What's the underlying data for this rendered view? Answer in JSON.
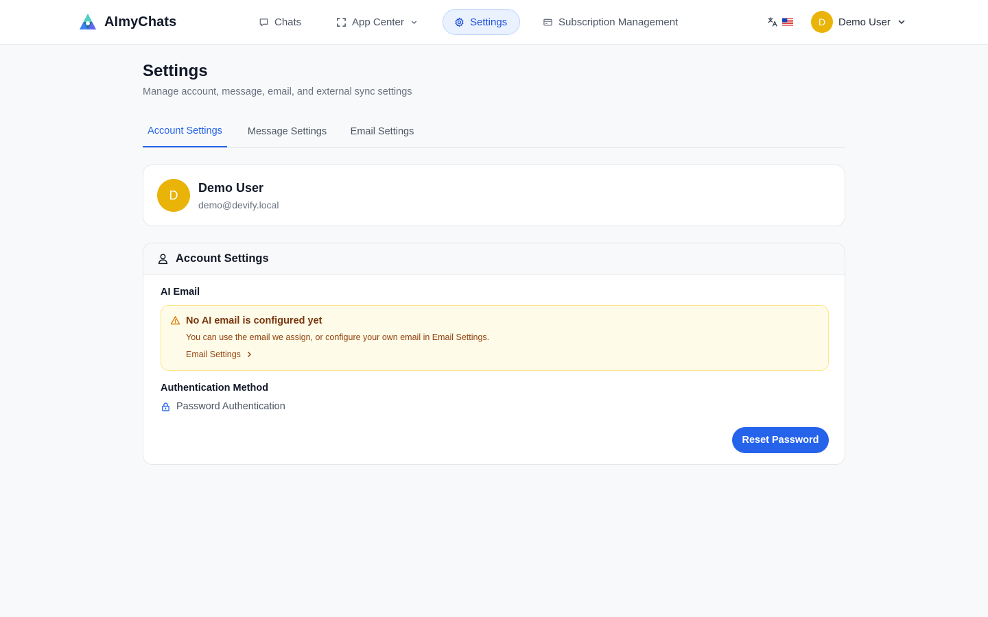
{
  "app": {
    "name": "AImyChats"
  },
  "nav": {
    "chats": "Chats",
    "app_center": "App Center",
    "settings": "Settings",
    "subscription": "Subscription Management"
  },
  "user": {
    "initial": "D",
    "name": "Demo User",
    "email": "demo@devify.local"
  },
  "page": {
    "title": "Settings",
    "subtitle": "Manage account, message, email, and external sync settings"
  },
  "tabs": [
    {
      "label": "Account Settings",
      "active": true
    },
    {
      "label": "Message Settings",
      "active": false
    },
    {
      "label": "Email Settings",
      "active": false
    }
  ],
  "account_settings": {
    "title": "Account Settings",
    "ai_email_label": "AI Email",
    "alert": {
      "title": "No AI email is configured yet",
      "text": "You can use the email we assign, or configure your own email in Email Settings.",
      "link": "Email Settings"
    },
    "auth_label": "Authentication Method",
    "auth_method": "Password Authentication",
    "reset_button": "Reset Password"
  },
  "colors": {
    "accent": "#2563eb",
    "avatar": "#eab308",
    "warning_bg": "#fefce8",
    "warning_border": "#fde68a",
    "warning_text": "#92400e"
  },
  "icons": {
    "logo": "aimychats-logo-icon",
    "chats": "chat-bubble-icon",
    "app_center": "app-grid-icon",
    "settings": "gear-icon",
    "subscription": "credit-card-icon",
    "language": "translate-icon",
    "flag": "us-flag-icon",
    "user_dropdown": "chevron-down-icon",
    "account": "user-icon",
    "alert": "warning-triangle-icon",
    "link": "chevron-right-icon",
    "auth": "lock-icon"
  }
}
